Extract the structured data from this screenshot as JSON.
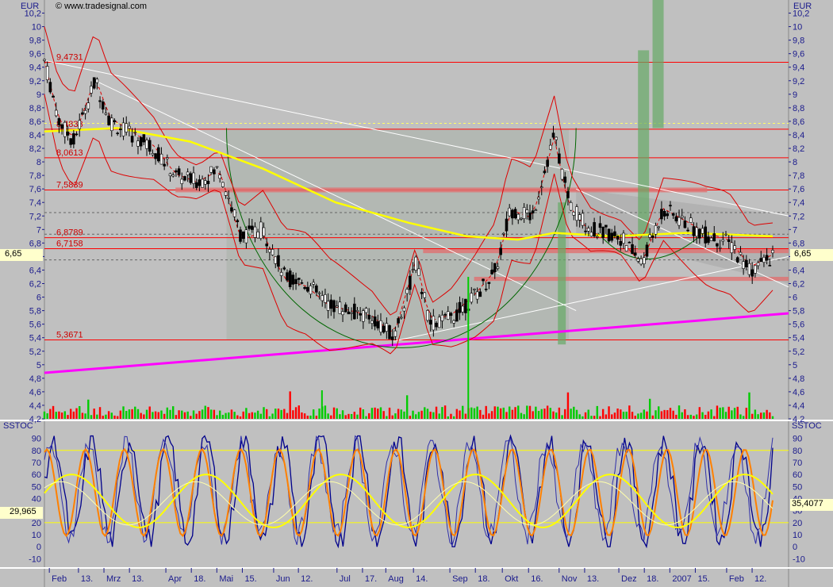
{
  "source": "© www.tradesignal.com",
  "currency": "EUR",
  "indicator": "SSTOC",
  "colors": {
    "background": "#c0c0c0",
    "level_line": "#ff0000",
    "ma_yellow": "#ffff00",
    "trend_magenta": "#ff00ff",
    "volume_green": "#00cc00",
    "volume_red": "#ff0000",
    "stoch_blue": "#00008b",
    "stoch_orange": "#ff8000",
    "stoch_yellow": "#ffff00",
    "highlight": "#ffffcc"
  },
  "price_axis": {
    "ticks": [
      "10,2",
      "10",
      "9,8",
      "9,6",
      "9,4",
      "9,2",
      "9",
      "8,8",
      "8,6",
      "8,4",
      "8,2",
      "8",
      "7,8",
      "7,6",
      "7,4",
      "7,2",
      "7",
      "6,8",
      "6,6",
      "6,4",
      "6,2",
      "6",
      "5,8",
      "5,6",
      "5,4",
      "5,2",
      "5",
      "4,8",
      "4,6",
      "4,4",
      "4,2"
    ],
    "current_left": "6,65",
    "current_right": "6,65"
  },
  "levels": [
    {
      "label": "9,4731",
      "value": 9.4731
    },
    {
      "label": "8,4833",
      "value": 8.4833
    },
    {
      "label": "8,0613",
      "value": 8.0613
    },
    {
      "label": "7,5839",
      "value": 7.5839
    },
    {
      "label": "6,8789",
      "value": 6.8789
    },
    {
      "label": "6,7158",
      "value": 6.7158
    },
    {
      "label": "5,3671",
      "value": 5.3671
    }
  ],
  "stoch_axis": {
    "ticks": [
      "90",
      "80",
      "70",
      "60",
      "50",
      "40",
      "30",
      "20",
      "10",
      "0",
      "-10"
    ],
    "current_left": "29,965",
    "current_right": "35,4077"
  },
  "time_axis": [
    "Feb",
    "13.",
    "Mrz",
    "13.",
    "Apr",
    "18.",
    "Mai",
    "15.",
    "Jun",
    "12.",
    "Jul",
    "17.",
    "Aug",
    "14.",
    "Sep",
    "18.",
    "Okt",
    "16.",
    "Nov",
    "13.",
    "Dez",
    "18.",
    "2007",
    "15.",
    "Feb",
    "12."
  ],
  "chart_data": {
    "type": "candlestick",
    "ylim": [
      4.2,
      10.3
    ],
    "close_path": [
      {
        "t": 0.0,
        "v": 9.5
      },
      {
        "t": 0.02,
        "v": 8.6
      },
      {
        "t": 0.04,
        "v": 8.3
      },
      {
        "t": 0.07,
        "v": 9.2
      },
      {
        "t": 0.09,
        "v": 8.6
      },
      {
        "t": 0.12,
        "v": 8.4
      },
      {
        "t": 0.15,
        "v": 8.2
      },
      {
        "t": 0.18,
        "v": 7.8
      },
      {
        "t": 0.21,
        "v": 7.7
      },
      {
        "t": 0.24,
        "v": 7.9
      },
      {
        "t": 0.27,
        "v": 6.9
      },
      {
        "t": 0.3,
        "v": 7.0
      },
      {
        "t": 0.33,
        "v": 6.3
      },
      {
        "t": 0.36,
        "v": 6.2
      },
      {
        "t": 0.39,
        "v": 5.9
      },
      {
        "t": 0.42,
        "v": 5.8
      },
      {
        "t": 0.45,
        "v": 5.7
      },
      {
        "t": 0.48,
        "v": 5.4
      },
      {
        "t": 0.51,
        "v": 6.5
      },
      {
        "t": 0.53,
        "v": 5.6
      },
      {
        "t": 0.56,
        "v": 5.7
      },
      {
        "t": 0.59,
        "v": 6.0
      },
      {
        "t": 0.62,
        "v": 6.4
      },
      {
        "t": 0.64,
        "v": 7.3
      },
      {
        "t": 0.67,
        "v": 7.2
      },
      {
        "t": 0.7,
        "v": 8.4
      },
      {
        "t": 0.72,
        "v": 7.4
      },
      {
        "t": 0.75,
        "v": 7.0
      },
      {
        "t": 0.79,
        "v": 6.9
      },
      {
        "t": 0.82,
        "v": 6.5
      },
      {
        "t": 0.85,
        "v": 7.3
      },
      {
        "t": 0.88,
        "v": 7.1
      },
      {
        "t": 0.91,
        "v": 6.9
      },
      {
        "t": 0.94,
        "v": 6.8
      },
      {
        "t": 0.97,
        "v": 6.4
      },
      {
        "t": 1.0,
        "v": 6.6
      }
    ],
    "ma_path": [
      {
        "t": 0.0,
        "v": 8.45
      },
      {
        "t": 0.1,
        "v": 8.5
      },
      {
        "t": 0.2,
        "v": 8.3
      },
      {
        "t": 0.3,
        "v": 7.9
      },
      {
        "t": 0.4,
        "v": 7.4
      },
      {
        "t": 0.5,
        "v": 7.1
      },
      {
        "t": 0.58,
        "v": 6.9
      },
      {
        "t": 0.65,
        "v": 6.85
      },
      {
        "t": 0.7,
        "v": 6.95
      },
      {
        "t": 0.78,
        "v": 6.9
      },
      {
        "t": 0.88,
        "v": 6.95
      },
      {
        "t": 1.0,
        "v": 6.9
      }
    ],
    "stoch_ylim": [
      -15,
      95
    ]
  }
}
